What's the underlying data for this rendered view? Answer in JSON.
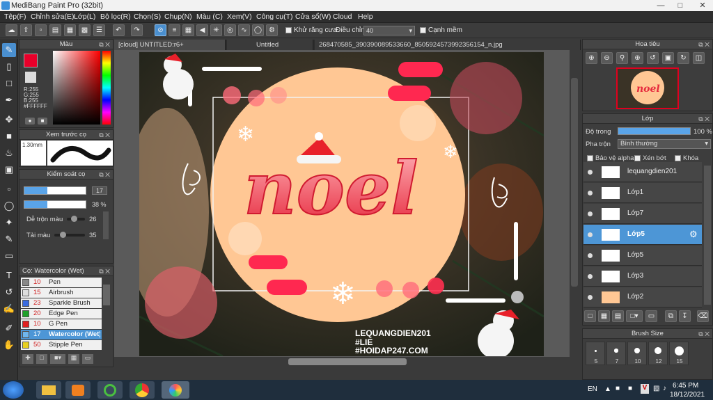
{
  "window": {
    "title": "MediBang Paint Pro (32bit)",
    "close_icon": "close-icon",
    "minimize_icon": "minimize-icon",
    "maximize_icon": "maximize-icon"
  },
  "menu": [
    "Tệp(F)",
    "Chỉnh sửa(E)",
    "Lớp(L)",
    "Bộ lọc(R)",
    "Chọn(S)",
    "Chụp(N)",
    "Màu (C)",
    "Xem(V)",
    "Công cụ(T)",
    "Cửa sổ(W)",
    "Cloud",
    "Help"
  ],
  "toolbar": {
    "antialias_label": "Khử răng cưa",
    "adjust_label": "Điều chỉnh",
    "adjust_value": "40",
    "smooth_label": "Cạnh mềm"
  },
  "color_panel": {
    "title": "Màu",
    "r": "R:255",
    "g": "G:255",
    "b": "B:255",
    "hex": "#FFFFFF",
    "fg_color": "#e8002a",
    "bg_color": "#ffffff"
  },
  "brush_preview": {
    "title": "Xem trước cọ",
    "size": "1.30mm"
  },
  "brush_control": {
    "title": "Kiểm soát cọ",
    "size_value": "17",
    "opacity_value": "38 %",
    "blend_label": "Dễ trộn màu",
    "blend_value": "26",
    "reload_label": "Tải màu",
    "reload_value": "35"
  },
  "brush_list": {
    "title": "Cọ: Watercolor (Wet)",
    "items": [
      {
        "size": "10",
        "name": "Pen",
        "color": "#888888"
      },
      {
        "size": "15",
        "name": "Airbrush",
        "color": "#dddddd"
      },
      {
        "size": "23",
        "name": "Sparkle Brush",
        "color": "#3a6be0"
      },
      {
        "size": "20",
        "name": "Edge Pen",
        "color": "#1fa02a"
      },
      {
        "size": "10",
        "name": "G Pen",
        "color": "#e02020"
      },
      {
        "size": "17",
        "name": "Watercolor (Wet)",
        "color": "#6fb6ee",
        "selected": true
      },
      {
        "size": "50",
        "name": "Stipple Pen",
        "color": "#e8d020"
      }
    ]
  },
  "tabs": [
    "[cloud] UNTITLED:r6+",
    "Untitled",
    "268470585_390390089533660_8505924573992356154_n.jpg"
  ],
  "artwork": {
    "title": "noel",
    "credit_line1": "LEQUANGDIEN201",
    "credit_line2": "#LIE",
    "credit_line3": "#HOIDAP247.COM"
  },
  "navigator": {
    "title": "Hoa tiêu"
  },
  "layers_panel": {
    "title": "Lớp",
    "opacity_label": "Độ trong",
    "opacity_value": "100 %",
    "blend_label": "Pha trộn",
    "blend_value": "Bình thường",
    "protect_alpha": "Bảo vệ alpha",
    "clipping": "Xén bớt",
    "lock": "Khóa",
    "layers": [
      {
        "name": "lequangdien201"
      },
      {
        "name": "Lớp1"
      },
      {
        "name": "Lớp7"
      },
      {
        "name": "Lớp5",
        "selected": true
      },
      {
        "name": "Lớp5"
      },
      {
        "name": "Lớp3"
      },
      {
        "name": "Lớp2"
      }
    ]
  },
  "brush_size_panel": {
    "title": "Brush Size",
    "sizes": [
      "5",
      "7",
      "10",
      "12",
      "15"
    ]
  },
  "taskbar": {
    "lang": "EN",
    "time": "6:45 PM",
    "date": "18/12/2021"
  }
}
